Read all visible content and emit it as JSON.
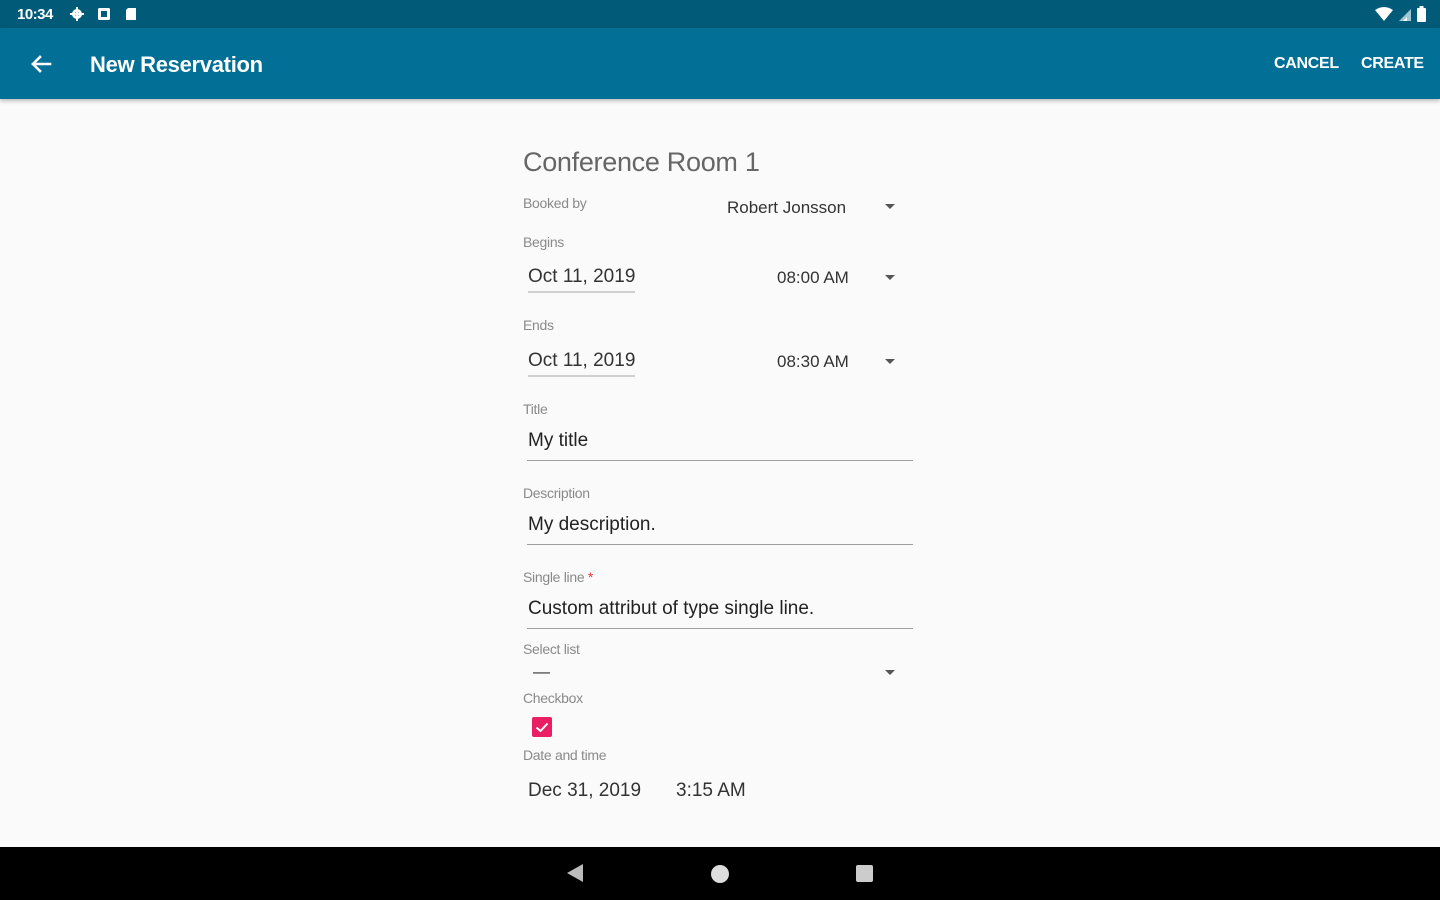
{
  "status_bar": {
    "time": "10:34"
  },
  "app_bar": {
    "title": "New Reservation",
    "cancel_label": "CANCEL",
    "create_label": "CREATE"
  },
  "form": {
    "room_name": "Conference Room 1",
    "booked_by": {
      "label": "Booked by",
      "value": "Robert Jonsson"
    },
    "begins": {
      "label": "Begins",
      "date": "Oct 11, 2019",
      "time": "08:00 AM"
    },
    "ends": {
      "label": "Ends",
      "date": "Oct 11, 2019",
      "time": "08:30 AM"
    },
    "title_field": {
      "label": "Title",
      "value": "My title"
    },
    "description_field": {
      "label": "Description",
      "value": "My description."
    },
    "single_line_field": {
      "label": "Single line",
      "required_marker": "*",
      "value": "Custom attribut of type single line."
    },
    "select_list": {
      "label": "Select list",
      "value": "—"
    },
    "checkbox": {
      "label": "Checkbox",
      "checked": true
    },
    "date_and_time": {
      "label": "Date and time",
      "date": "Dec 31, 2019",
      "time": "3:15 AM"
    }
  },
  "colors": {
    "status_bar": "#005a78",
    "app_bar": "#016f96",
    "checkbox_accent": "#e91e63",
    "nav_bar": "#000000"
  },
  "icons": {
    "back": "arrow-left-icon",
    "settings": "gear-icon",
    "notification": "square-icon",
    "sd_card": "sd-card-icon",
    "wifi": "wifi-icon",
    "signal": "signal-icon",
    "battery": "battery-icon"
  }
}
